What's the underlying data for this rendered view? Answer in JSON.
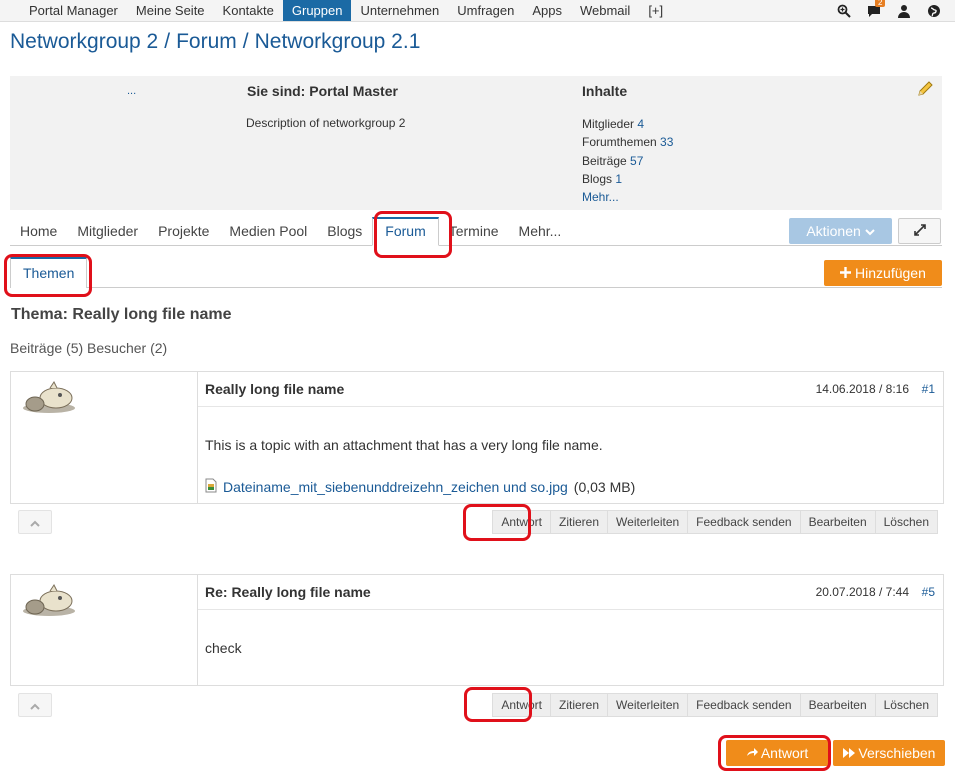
{
  "topnav": {
    "items": [
      "Portal Manager",
      "Meine Seite",
      "Kontakte",
      "Gruppen",
      "Unternehmen",
      "Umfragen",
      "Apps",
      "Webmail",
      "[+]"
    ],
    "active": "Gruppen",
    "badge_count": "2"
  },
  "breadcrumb": [
    "Networkgroup 2",
    "Forum",
    "Networkgroup 2.1"
  ],
  "infobox": {
    "dots": "...",
    "role": "Sie sind: Portal Master",
    "description": "Description of networkgroup 2",
    "contents_title": "Inhalte",
    "stats": [
      {
        "label": "Mitglieder",
        "value": "4"
      },
      {
        "label": "Forumthemen",
        "value": "33"
      },
      {
        "label": "Beiträge",
        "value": "57"
      },
      {
        "label": "Blogs",
        "value": "1"
      }
    ],
    "more": "Mehr..."
  },
  "tabs": [
    "Home",
    "Mitglieder",
    "Projekte",
    "Medien Pool",
    "Blogs",
    "Forum",
    "Termine",
    "Mehr..."
  ],
  "active_tab": "Forum",
  "actions_label": "Aktionen",
  "subtab": "Themen",
  "add_label": "Hinzufügen",
  "thread": {
    "title": "Thema: Really long file name",
    "stats": "Beiträge (5) Besucher (2)"
  },
  "posts": [
    {
      "title": "Really long file name",
      "date": "14.06.2018 / 8:16",
      "num": "#1",
      "body": "This is a topic with an attachment that has a very long file name.",
      "attachment": "Dateiname_mit_siebenunddreizehn_zeichen und so.jpg",
      "attachment_size": "(0,03 MB)"
    },
    {
      "title": "Re: Really long file name",
      "date": "20.07.2018 / 7:44",
      "num": "#5",
      "body": "check"
    }
  ],
  "post_actions": [
    "Antwort",
    "Zitieren",
    "Weiterleiten",
    "Feedback senden",
    "Bearbeiten",
    "Löschen"
  ],
  "bottom": {
    "reply_label": "Antwort",
    "move_label": "Verschieben"
  },
  "colors": {
    "brand": "#1b6aa5",
    "accent": "#f08c1a",
    "highlight": "#e0101a"
  }
}
